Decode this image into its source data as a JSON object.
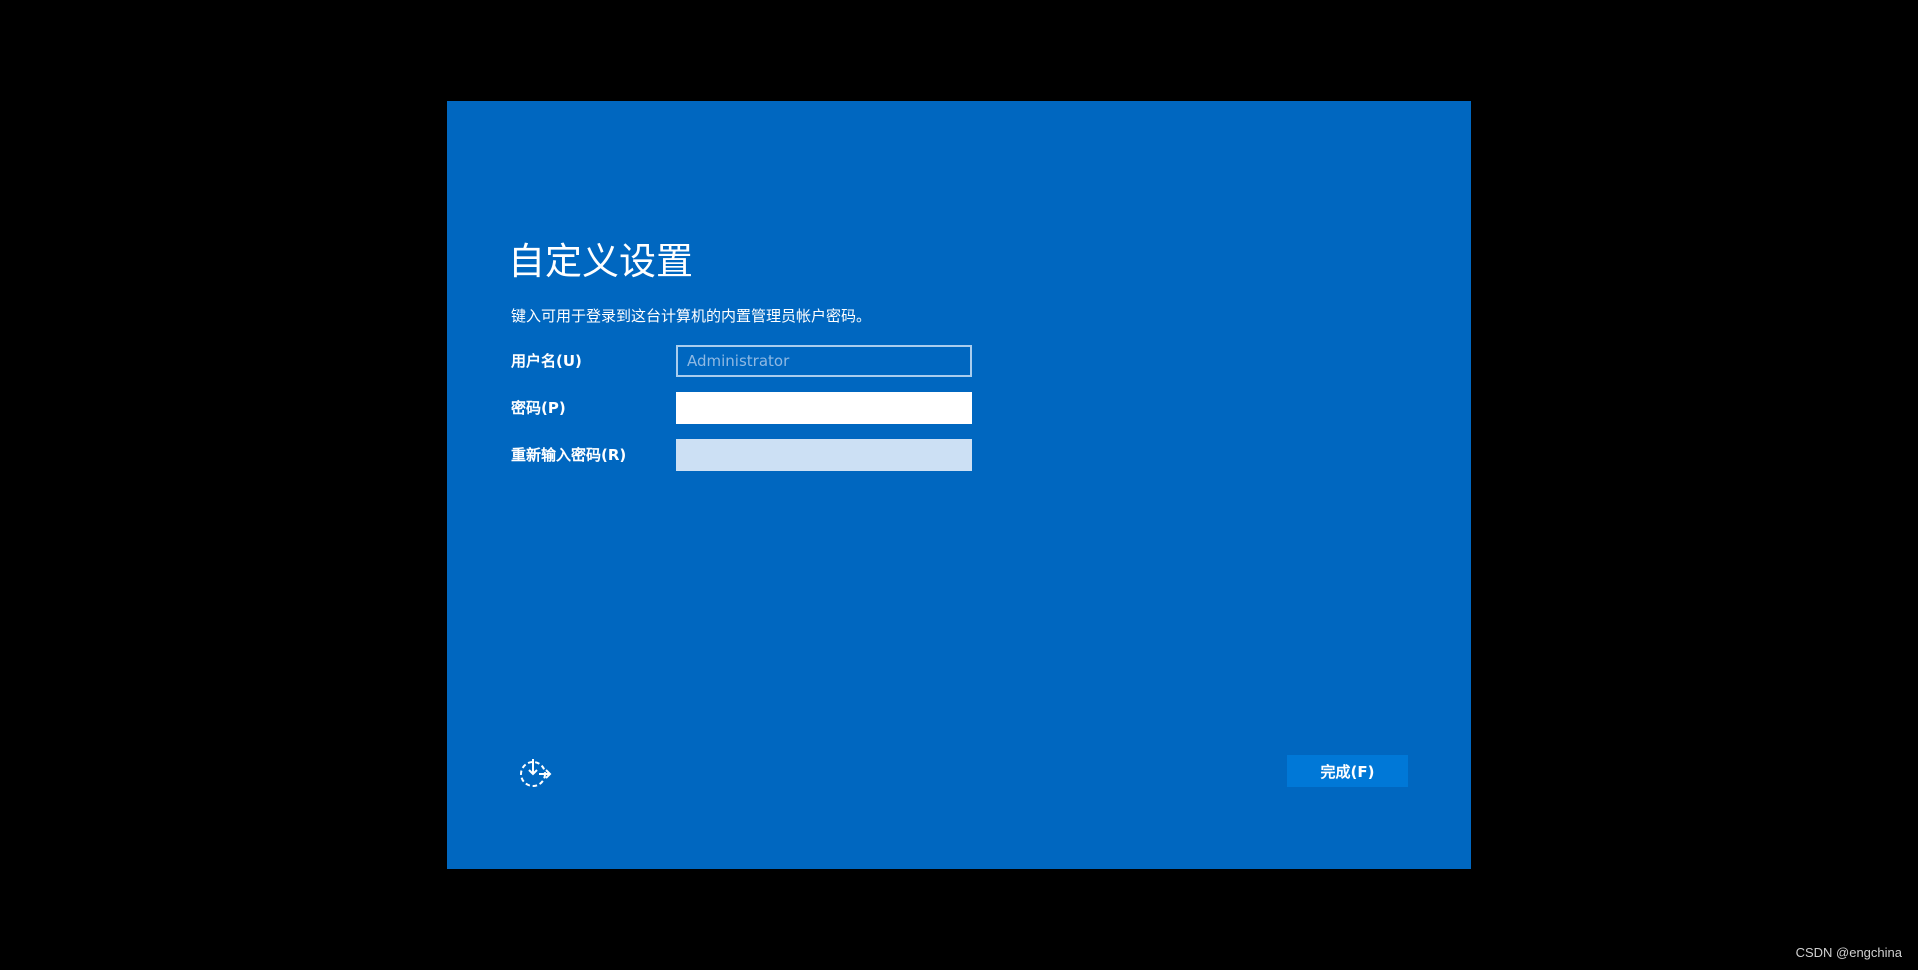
{
  "setup": {
    "title": "自定义设置",
    "instruction": "键入可用于登录到这台计算机的内置管理员帐户密码。",
    "fields": {
      "username": {
        "label": "用户名(U)",
        "placeholder": "Administrator",
        "value": ""
      },
      "password": {
        "label": "密码(P)",
        "value": ""
      },
      "reenter_password": {
        "label": "重新输入密码(R)",
        "value": ""
      }
    },
    "finish_button": "完成(F)",
    "accessibility_icon": "ease-of-access-icon"
  },
  "watermark": "CSDN @engchina",
  "colors": {
    "background": "#000000",
    "panel": "#0067c0",
    "button": "#0078d7",
    "text": "#ffffff"
  }
}
